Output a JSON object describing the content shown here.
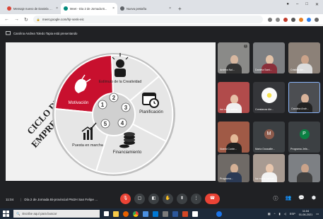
{
  "browser": {
    "tabs": [
      {
        "label": "Mensaje nuevo de Daniela Da...",
        "favicon_color": "#db4437"
      },
      {
        "label": "Meet - Dia 2 de Jornada B...",
        "favicon_color": "#00897b"
      },
      {
        "label": "Nueva pestaña",
        "favicon_color": "#5f6368"
      }
    ],
    "url": "meet.google.com/hjr-senk-eic"
  },
  "meet": {
    "presenting_text": "Carolina Andrea Toledo Tapia está presentando",
    "slide": {
      "title_line1": "CICLO DEL",
      "title_line2": "EMPRENDIMIENTO",
      "segments": [
        {
          "label": "Motivación",
          "number": "1",
          "color": "#c8102e"
        },
        {
          "label": "Estímulo de la Creatividad",
          "number": "2",
          "color": "#e9e9e9"
        },
        {
          "label": "Planificación",
          "number": "3",
          "color": "#e9e9e9"
        },
        {
          "label": "Financiamiento",
          "number": "4",
          "color": "#e9e9e9"
        },
        {
          "label": "Puesta en marcha",
          "number": "5",
          "color": "#e9e9e9"
        }
      ]
    },
    "participants": [
      {
        "name": "Andrea Nol...",
        "type": "video",
        "bg": "#8a8a88"
      },
      {
        "name": "Daniela Sant...",
        "type": "video",
        "bg": "#7d7f82"
      },
      {
        "name": "Cristina Ale...",
        "type": "video",
        "bg": "#8c8178"
      },
      {
        "name": "luz maria salina...",
        "type": "video",
        "bg": "#b14b4b"
      },
      {
        "name": "Constanza Ale...",
        "type": "video",
        "bg": "#35363a"
      },
      {
        "name": "Carolina Andr...",
        "type": "video",
        "bg": "#4c4e52"
      },
      {
        "name": "Noemi Conte...",
        "type": "video",
        "bg": "#a05a46"
      },
      {
        "name": "María Oussaille...",
        "type": "avatar",
        "initial": "M",
        "bg": "#3c4043",
        "avatar_color": "#8d5b4c"
      },
      {
        "name": "Programa Jefa...",
        "type": "avatar",
        "initial": "P",
        "bg": "#3c4043",
        "avatar_color": "#0b8043"
      },
      {
        "name": "Programa...",
        "type": "video",
        "bg": "#6f6a66"
      },
      {
        "name": "luz maria salinas",
        "type": "video",
        "bg": "#a89b92"
      },
      {
        "name": "",
        "type": "video",
        "bg": "#7d8084"
      }
    ],
    "meeting_time": "11:04",
    "meeting_title": "Día 2 de Jornada Bi-provincial PMJH San Felipe ..."
  },
  "taskbar": {
    "search_placeholder": "Escribe aquí para buscar",
    "clock_time": "11:04",
    "clock_date": "01-06-2021",
    "lang": "ESP"
  }
}
